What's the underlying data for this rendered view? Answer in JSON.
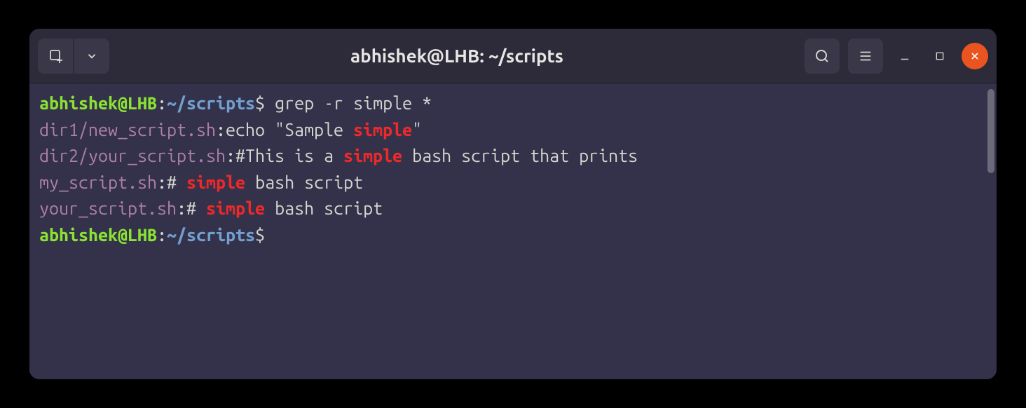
{
  "window": {
    "title": "abhishek@LHB: ~/scripts"
  },
  "prompt": {
    "user": "abhishek@LHB",
    "sep1": ":",
    "path": "~/scripts",
    "sep2": "$"
  },
  "lines": [
    {
      "type": "prompt",
      "command": " grep -r simple *"
    },
    {
      "type": "output",
      "segments": [
        {
          "text": "dir1/new_script.sh",
          "class": "c-purple"
        },
        {
          "text": ":",
          "class": "c-white"
        },
        {
          "text": "echo \"Sample ",
          "class": "c-white"
        },
        {
          "text": "simple",
          "class": "c-red"
        },
        {
          "text": "\"",
          "class": "c-white"
        }
      ]
    },
    {
      "type": "output",
      "segments": [
        {
          "text": "dir2/your_script.sh",
          "class": "c-purple"
        },
        {
          "text": ":",
          "class": "c-white"
        },
        {
          "text": "#This is a ",
          "class": "c-white"
        },
        {
          "text": "simple",
          "class": "c-red"
        },
        {
          "text": " bash script that prints",
          "class": "c-white"
        }
      ]
    },
    {
      "type": "output",
      "segments": [
        {
          "text": "my_script.sh",
          "class": "c-purple"
        },
        {
          "text": ":",
          "class": "c-white"
        },
        {
          "text": "# ",
          "class": "c-white"
        },
        {
          "text": "simple",
          "class": "c-red"
        },
        {
          "text": " bash script",
          "class": "c-white"
        }
      ]
    },
    {
      "type": "output",
      "segments": [
        {
          "text": "your_script.sh",
          "class": "c-purple"
        },
        {
          "text": ":",
          "class": "c-white"
        },
        {
          "text": "# ",
          "class": "c-white"
        },
        {
          "text": "simple",
          "class": "c-red"
        },
        {
          "text": " bash script",
          "class": "c-white"
        }
      ]
    },
    {
      "type": "prompt",
      "command": ""
    }
  ]
}
